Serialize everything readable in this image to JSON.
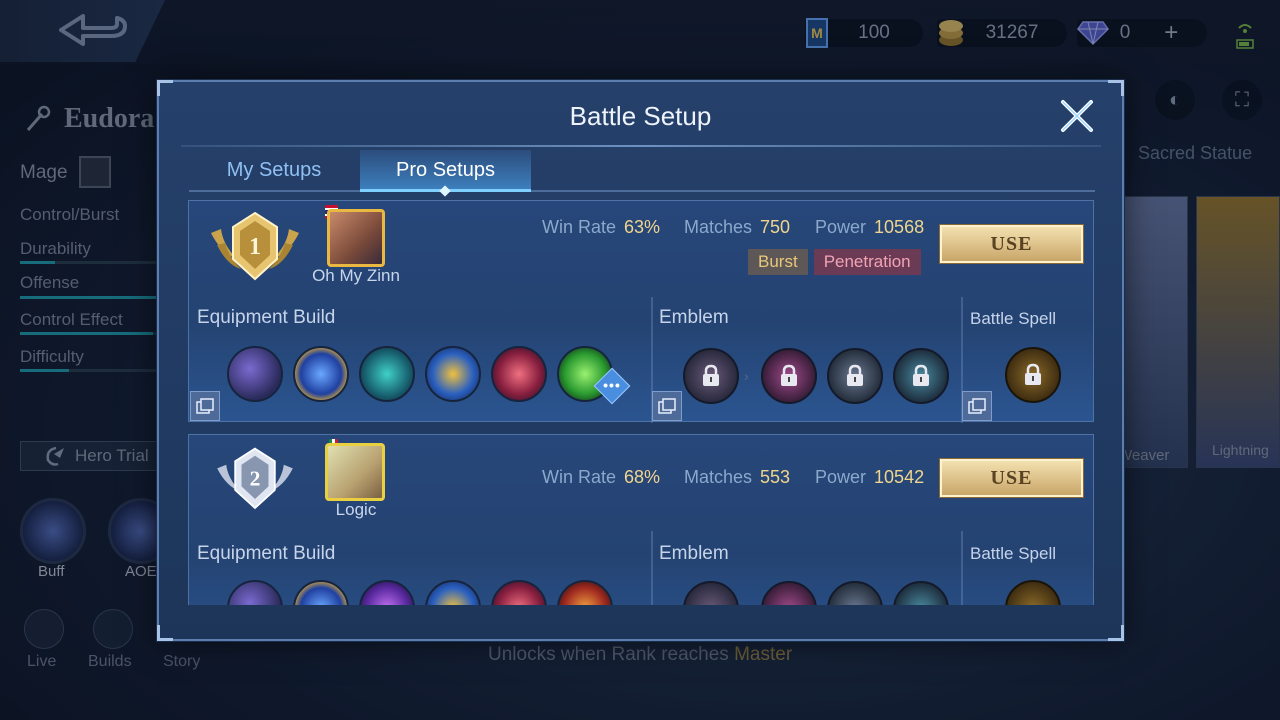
{
  "background": {
    "currencies": [
      {
        "name": "ticket",
        "value": "100"
      },
      {
        "name": "battle-points",
        "value": "31267"
      },
      {
        "name": "diamonds",
        "value": "0"
      }
    ],
    "hero": {
      "name": "Eudora",
      "role": "Mage",
      "stats": [
        {
          "label": "Control/Burst",
          "level": 0
        },
        {
          "label": "Durability",
          "level": 0.25
        },
        {
          "label": "Offense",
          "level": 1.0
        },
        {
          "label": "Control Effect",
          "level": 0.95
        },
        {
          "label": "Difficulty",
          "level": 0.35
        }
      ],
      "trial_label": "Hero Trial",
      "skills": [
        {
          "label": "Buff"
        },
        {
          "label": "AOE"
        }
      ],
      "bottom_links": [
        "Live",
        "Builds",
        "Story"
      ]
    },
    "right_tab_label": "Sacred Statue",
    "skins": [
      {
        "label": "Weaver"
      },
      {
        "label": "Lightning"
      }
    ],
    "unlock_text": "Unlocks when Rank reaches ",
    "unlock_rank": "Master"
  },
  "modal": {
    "title": "Battle Setup",
    "tabs": [
      {
        "label": "My Setups",
        "active": false
      },
      {
        "label": "Pro Setups",
        "active": true
      }
    ],
    "setups": [
      {
        "rank": "1",
        "player": "Oh My Zinn",
        "win_rate_label": "Win Rate",
        "win_rate": "63%",
        "matches_label": "Matches",
        "matches": "750",
        "power_label": "Power",
        "power": "10568",
        "tags": [
          "Burst",
          "Penetration"
        ],
        "use_label": "USE",
        "equipment_label": "Equipment Build",
        "emblem_label": "Emblem",
        "spell_label": "Battle Spell",
        "more_badge": "•••",
        "items": [
          "boots-icon",
          "blue-orb-icon",
          "teal-staff-icon",
          "golden-trident-icon",
          "crimson-wand-icon",
          "green-crystal-icon"
        ],
        "emblems": [
          "magic-emblem-icon",
          "talent-swirl-icon",
          "talent-feather-icon",
          "talent-cycle-icon"
        ],
        "spell": "golden-figure-spell-icon"
      },
      {
        "rank": "2",
        "player": "Logic",
        "win_rate_label": "Win Rate",
        "win_rate": "68%",
        "matches_label": "Matches",
        "matches": "553",
        "power_label": "Power",
        "power": "10542",
        "tags": [],
        "use_label": "USE",
        "equipment_label": "Equipment Build",
        "emblem_label": "Emblem",
        "spell_label": "Battle Spell",
        "items": [
          "boots-icon",
          "blue-orb-icon",
          "violet-wing-icon",
          "golden-trident-icon",
          "crimson-wand-icon",
          "flame-book-icon"
        ],
        "emblems": [
          "magic-emblem-icon",
          "talent-swirl-icon",
          "talent-feather-icon",
          "talent-cycle-icon"
        ],
        "spell": "golden-figure-spell-icon"
      }
    ]
  },
  "colors": {
    "accent_gold": "#f0d58e",
    "tab_blue": "#8fc0f2",
    "modal_bg": "#25406a",
    "use_button": "#dcc088"
  }
}
